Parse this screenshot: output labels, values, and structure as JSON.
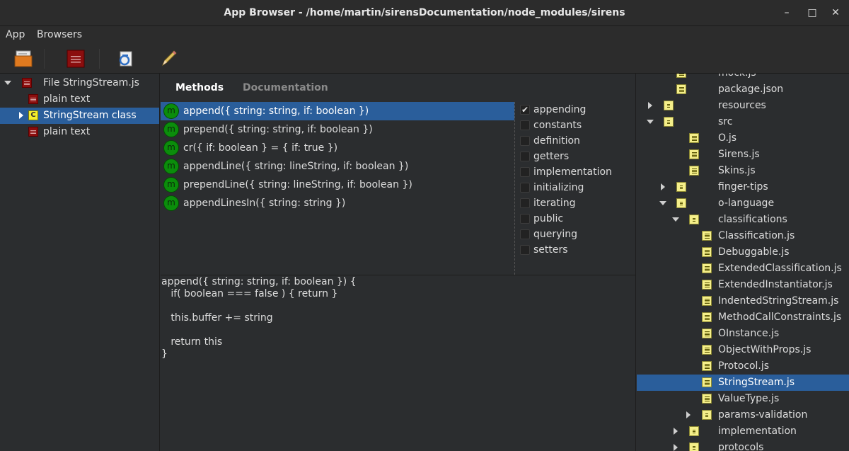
{
  "window": {
    "title": "App Browser - /home/martin/sirensDocumentation/node_modules/sirens",
    "minimize_glyph": "–",
    "maximize_glyph": "□",
    "close_glyph": "✕"
  },
  "menu": [
    "App",
    "Browsers"
  ],
  "toolbar": {
    "icons": [
      "open-folder-icon",
      "class-file-icon",
      "refresh-icon",
      "pencil-icon"
    ]
  },
  "left_tree": {
    "items": [
      {
        "label": "File StringStream.js",
        "icon": "red-file-icon",
        "expander": "down"
      },
      {
        "label": "plain text",
        "icon": "red-file-icon"
      },
      {
        "label": "StringStream class",
        "icon": "class-icon",
        "icon_letter": "C",
        "expander": "right",
        "selected": true
      },
      {
        "label": "plain text",
        "icon": "red-file-icon"
      }
    ]
  },
  "tabs": [
    {
      "label": "Methods",
      "active": true
    },
    {
      "label": "Documentation",
      "active": false
    }
  ],
  "methods": {
    "icon_letter": "m",
    "items": [
      {
        "label": "append({ string: string, if: boolean })",
        "selected": true
      },
      {
        "label": "prepend({ string: string, if: boolean })"
      },
      {
        "label": "cr({ if: boolean } = { if: true })"
      },
      {
        "label": "appendLine({ string: lineString, if: boolean })"
      },
      {
        "label": "prependLine({ string: lineString, if: boolean })"
      },
      {
        "label": "appendLinesIn({ string: string })"
      }
    ]
  },
  "categories": {
    "check_glyph": "✔",
    "items": [
      {
        "label": "appending",
        "checked": true
      },
      {
        "label": "constants",
        "checked": false
      },
      {
        "label": "definition",
        "checked": false
      },
      {
        "label": "getters",
        "checked": false
      },
      {
        "label": "implementation",
        "checked": false
      },
      {
        "label": "initializing",
        "checked": false
      },
      {
        "label": "iterating",
        "checked": false
      },
      {
        "label": "public",
        "checked": false
      },
      {
        "label": "querying",
        "checked": false
      },
      {
        "label": "setters",
        "checked": false
      }
    ]
  },
  "source_code": "append({ string: string, if: boolean }) {\n   if( boolean === false ) { return }\n\n   this.buffer += string\n\n   return this\n}",
  "file_tree": {
    "items": [
      {
        "label": "mock.js",
        "type": "file",
        "depth": 3,
        "partial": true
      },
      {
        "label": "package.json",
        "type": "file",
        "depth": 3
      },
      {
        "label": "resources",
        "type": "folder",
        "depth": 2,
        "expander": "right"
      },
      {
        "label": "src",
        "type": "folder",
        "depth": 2,
        "expander": "down"
      },
      {
        "label": "O.js",
        "type": "file",
        "depth": 4
      },
      {
        "label": "Sirens.js",
        "type": "file",
        "depth": 4
      },
      {
        "label": "Skins.js",
        "type": "file",
        "depth": 4
      },
      {
        "label": "finger-tips",
        "type": "folder",
        "depth": 3,
        "expander": "right"
      },
      {
        "label": "o-language",
        "type": "folder",
        "depth": 3,
        "expander": "down"
      },
      {
        "label": "classifications",
        "type": "folder",
        "depth": 4,
        "expander": "down"
      },
      {
        "label": "Classification.js",
        "type": "file",
        "depth": 5
      },
      {
        "label": "Debuggable.js",
        "type": "file",
        "depth": 5
      },
      {
        "label": "ExtendedClassification.js",
        "type": "file",
        "depth": 5
      },
      {
        "label": "ExtendedInstantiator.js",
        "type": "file",
        "depth": 5
      },
      {
        "label": "IndentedStringStream.js",
        "type": "file",
        "depth": 5
      },
      {
        "label": "MethodCallConstraints.js",
        "type": "file",
        "depth": 5
      },
      {
        "label": "OInstance.js",
        "type": "file",
        "depth": 5
      },
      {
        "label": "ObjectWithProps.js",
        "type": "file",
        "depth": 5
      },
      {
        "label": "Protocol.js",
        "type": "file",
        "depth": 5
      },
      {
        "label": "StringStream.js",
        "type": "file",
        "depth": 5,
        "selected": true
      },
      {
        "label": "ValueType.js",
        "type": "file",
        "depth": 5
      },
      {
        "label": "params-validation",
        "type": "folder",
        "depth": 5,
        "expander": "right"
      },
      {
        "label": "implementation",
        "type": "folder",
        "depth": 4,
        "expander": "right"
      },
      {
        "label": "protocols",
        "type": "folder",
        "depth": 4,
        "expander": "right"
      }
    ]
  },
  "colors": {
    "selection": "#2a5e9b",
    "background": "#2b2d2f",
    "method_icon": "#0b8d0b"
  }
}
